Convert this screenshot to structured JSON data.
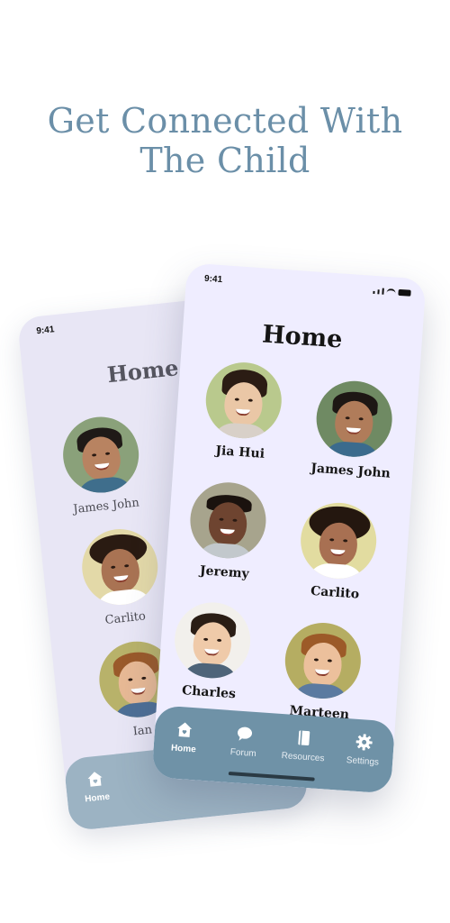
{
  "headline": {
    "line1": "Get Connected With",
    "line2": "The Child"
  },
  "back_phone": {
    "status_time": "9:41",
    "title": "Home",
    "children": [
      {
        "name": "James John"
      },
      {
        "name": "Carlito"
      },
      {
        "name": "Ian"
      }
    ],
    "nav": [
      {
        "label": "Home",
        "icon": "home-icon",
        "active": true
      }
    ]
  },
  "front_phone": {
    "status_time": "9:41",
    "title": "Home",
    "children": [
      {
        "name": "Jia Hui"
      },
      {
        "name": "James John"
      },
      {
        "name": "Jeremy"
      },
      {
        "name": "Carlito"
      },
      {
        "name": "Charles"
      },
      {
        "name": "Marteen"
      }
    ],
    "nav": [
      {
        "label": "Home",
        "icon": "home-icon",
        "active": true
      },
      {
        "label": "Forum",
        "icon": "chat-bubble-icon",
        "active": false
      },
      {
        "label": "Resources",
        "icon": "book-icon",
        "active": false
      },
      {
        "label": "Settings",
        "icon": "gear-icon",
        "active": false
      }
    ]
  },
  "colors": {
    "headline": "#6b8fa8",
    "nav_bar": "#6f92a7",
    "screen_bg": "#efedff"
  }
}
